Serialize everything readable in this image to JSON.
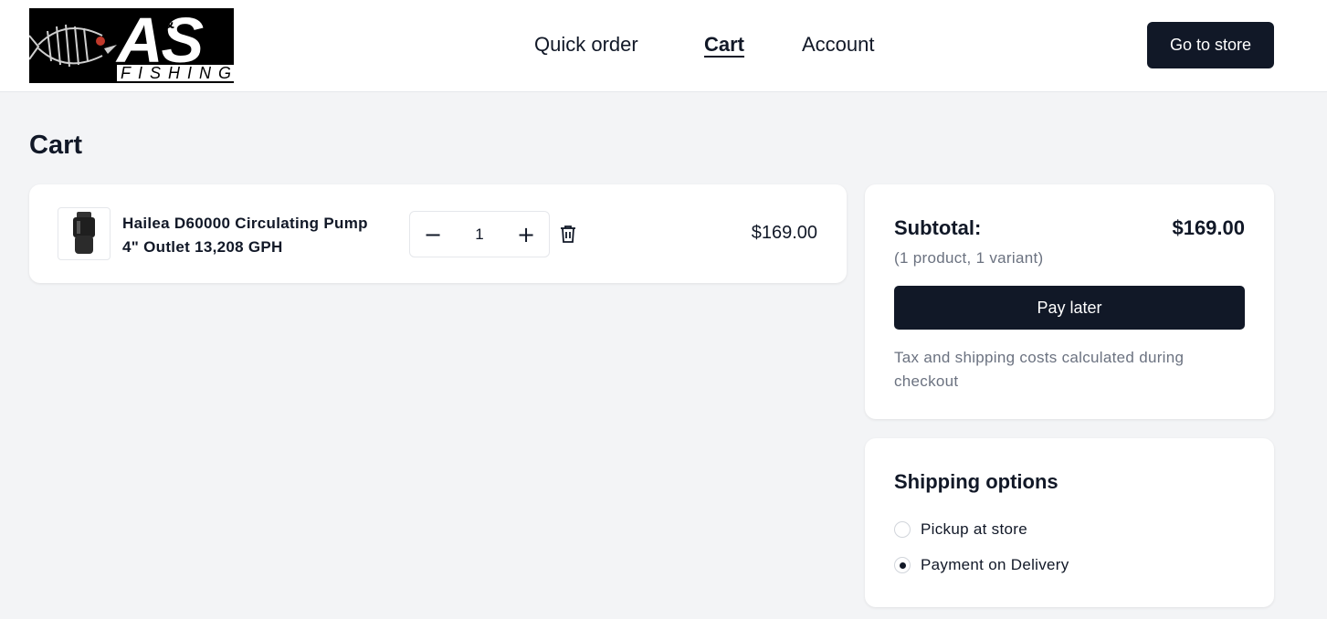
{
  "header": {
    "logo": {
      "mark": "AS",
      "ampersand": "&",
      "word": "FISHING"
    },
    "nav": [
      {
        "label": "Quick order",
        "active": false
      },
      {
        "label": "Cart",
        "active": true
      },
      {
        "label": "Account",
        "active": false
      }
    ],
    "go_to_store_label": "Go to store"
  },
  "page": {
    "title": "Cart"
  },
  "cart": {
    "items": [
      {
        "name": "Hailea D60000 Circulating Pump 4\" Outlet 13,208 GPH",
        "quantity": "1",
        "price": "$169.00",
        "image_icon": "pump-product-image",
        "delete_icon": "trash-icon"
      }
    ]
  },
  "summary": {
    "subtotal_label": "Subtotal:",
    "subtotal_value": "$169.00",
    "meta": "(1 product, 1 variant)",
    "pay_later_label": "Pay later",
    "tax_note": "Tax and shipping costs calculated during checkout"
  },
  "shipping": {
    "title": "Shipping options",
    "options": [
      {
        "label": "Pickup at store",
        "selected": false
      },
      {
        "label": "Payment on Delivery",
        "selected": true
      }
    ]
  },
  "colors": {
    "primary": "#111827",
    "background": "#f3f4f6",
    "muted_text": "#6b7280"
  }
}
